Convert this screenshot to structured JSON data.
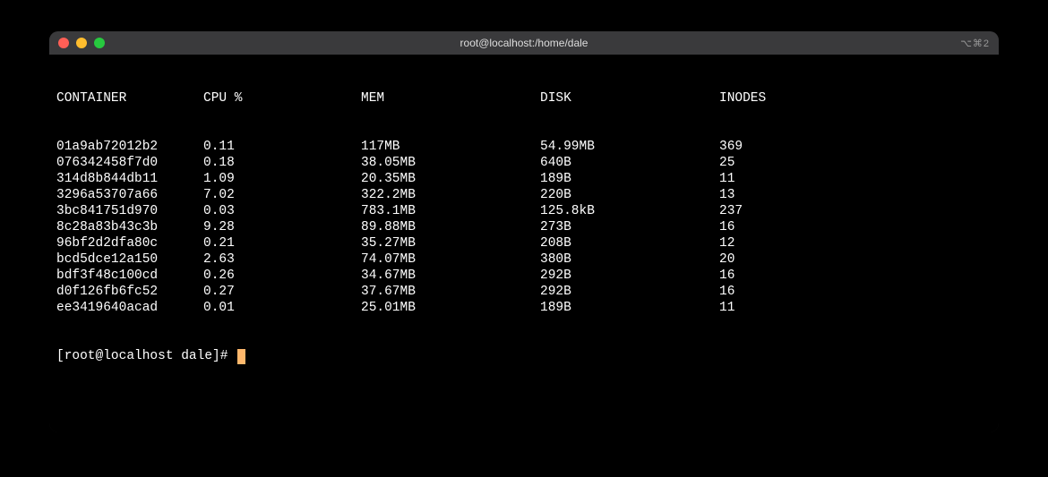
{
  "window": {
    "title": "root@localhost:/home/dale",
    "right_label": "⌥⌘2"
  },
  "headers": {
    "container": "CONTAINER",
    "cpu": "CPU %",
    "mem": "MEM",
    "disk": "DISK",
    "inodes": "INODES"
  },
  "rows": [
    {
      "container": "01a9ab72012b2",
      "cpu": "0.11",
      "mem": "117MB",
      "disk": "54.99MB",
      "inodes": "369"
    },
    {
      "container": "076342458f7d0",
      "cpu": "0.18",
      "mem": "38.05MB",
      "disk": "640B",
      "inodes": "25"
    },
    {
      "container": "314d8b844db11",
      "cpu": "1.09",
      "mem": "20.35MB",
      "disk": "189B",
      "inodes": "11"
    },
    {
      "container": "3296a53707a66",
      "cpu": "7.02",
      "mem": "322.2MB",
      "disk": "220B",
      "inodes": "13"
    },
    {
      "container": "3bc841751d970",
      "cpu": "0.03",
      "mem": "783.1MB",
      "disk": "125.8kB",
      "inodes": "237"
    },
    {
      "container": "8c28a83b43c3b",
      "cpu": "9.28",
      "mem": "89.88MB",
      "disk": "273B",
      "inodes": "16"
    },
    {
      "container": "96bf2d2dfa80c",
      "cpu": "0.21",
      "mem": "35.27MB",
      "disk": "208B",
      "inodes": "12"
    },
    {
      "container": "bcd5dce12a150",
      "cpu": "2.63",
      "mem": "74.07MB",
      "disk": "380B",
      "inodes": "20"
    },
    {
      "container": "bdf3f48c100cd",
      "cpu": "0.26",
      "mem": "34.67MB",
      "disk": "292B",
      "inodes": "16"
    },
    {
      "container": "d0f126fb6fc52",
      "cpu": "0.27",
      "mem": "37.67MB",
      "disk": "292B",
      "inodes": "16"
    },
    {
      "container": "ee3419640acad",
      "cpu": "0.01",
      "mem": "25.01MB",
      "disk": "189B",
      "inodes": "11"
    }
  ],
  "prompt": "[root@localhost dale]# "
}
